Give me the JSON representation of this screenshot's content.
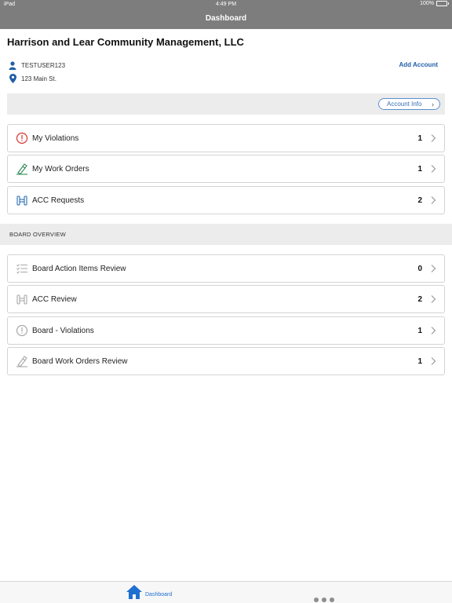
{
  "status_bar": {
    "device": "iPad",
    "time": "4:49 PM",
    "battery": "100%",
    "battery_level": 1.0
  },
  "nav": {
    "title": "Dashboard"
  },
  "account": {
    "company": "Harrison and Lear Community Management, LLC",
    "user": "TESTUSER123",
    "address": "123 Main St.",
    "add_account_label": "Add Account",
    "account_info_label": "Account Info"
  },
  "my_items": [
    {
      "label": "My Violations",
      "count": "1",
      "icon": "violation-icon"
    },
    {
      "label": "My Work Orders",
      "count": "1",
      "icon": "work-order-icon"
    },
    {
      "label": "ACC Requests",
      "count": "2",
      "icon": "acc-request-icon"
    }
  ],
  "board": {
    "section_title": "BOARD OVERVIEW",
    "items": [
      {
        "label": "Board Action Items Review",
        "count": "0",
        "icon": "checklist-icon"
      },
      {
        "label": "ACC Review",
        "count": "2",
        "icon": "acc-review-icon"
      },
      {
        "label": "Board - Violations",
        "count": "1",
        "icon": "violation-icon"
      },
      {
        "label": "Board Work Orders Review",
        "count": "1",
        "icon": "work-order-icon"
      }
    ]
  },
  "tab_bar": {
    "home_label": "Dashboard",
    "accent": "#1f6fd1"
  },
  "colors": {
    "header_gray": "#7d7d7d",
    "link_blue": "#1f5fa8",
    "violation_red": "#d9342b",
    "work_green": "#2e8b57",
    "acc_blue": "#2a6db5"
  }
}
